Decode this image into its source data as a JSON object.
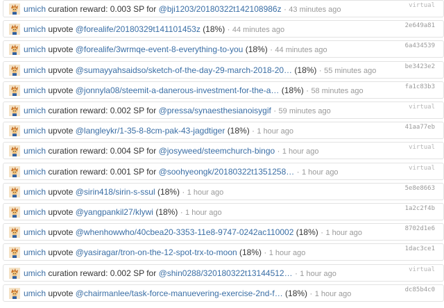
{
  "avatar_icon": "orange-cartoon-character-avatar",
  "colors": {
    "link": "#3a6ea5",
    "muted": "#999999",
    "border": "#e2e2e2"
  },
  "rows": [
    {
      "account": "umich",
      "op": "curation reward: 0.003 SP for",
      "link": "@bji1203/20180322t142108986z",
      "pct": "",
      "time": "43 minutes ago",
      "tx": "virtual"
    },
    {
      "account": "umich",
      "op": "upvote",
      "link": "@forealife/20180329t141101453z",
      "pct": "(18%)",
      "time": "44 minutes ago",
      "tx": "2e649a81"
    },
    {
      "account": "umich",
      "op": "upvote",
      "link": "@forealife/3wrmqe-event-8-everything-to-you",
      "pct": "(18%)",
      "time": "44 minutes ago",
      "tx": "6a434539"
    },
    {
      "account": "umich",
      "op": "upvote",
      "link": "@sumayyahsaidso/sketch-of-the-day-29-march-2018-20…",
      "pct": "(18%)",
      "time": "55 minutes ago",
      "tx": "be3423e2"
    },
    {
      "account": "umich",
      "op": "upvote",
      "link": "@jonnyla08/steemit-a-danerous-investment-for-the-a…",
      "pct": "(18%)",
      "time": "58 minutes ago",
      "tx": "fa1c83b3"
    },
    {
      "account": "umich",
      "op": "curation reward: 0.002 SP for",
      "link": "@pressa/synaesthesianoisygif",
      "pct": "",
      "time": "59 minutes ago",
      "tx": "virtual"
    },
    {
      "account": "umich",
      "op": "upvote",
      "link": "@langleykr/1-35-8-8cm-pak-43-jagdtiger",
      "pct": "(18%)",
      "time": "1 hour ago",
      "tx": "41aa77eb"
    },
    {
      "account": "umich",
      "op": "curation reward: 0.004 SP for",
      "link": "@josyweed/steemchurch-bingo",
      "pct": "",
      "time": "1 hour ago",
      "tx": "virtual"
    },
    {
      "account": "umich",
      "op": "curation reward: 0.001 SP for",
      "link": "@soohyeongk/20180322t1351258…",
      "pct": "",
      "time": "1 hour ago",
      "tx": "virtual"
    },
    {
      "account": "umich",
      "op": "upvote",
      "link": "@sirin418/sirin-s-ssul",
      "pct": "(18%)",
      "time": "1 hour ago",
      "tx": "5e8e8663"
    },
    {
      "account": "umich",
      "op": "upvote",
      "link": "@yangpankil27/klywi",
      "pct": "(18%)",
      "time": "1 hour ago",
      "tx": "1a2c2f4b"
    },
    {
      "account": "umich",
      "op": "upvote",
      "link": "@whenhowwho/40cbea20-3353-11e8-9747-0242ac110002",
      "pct": "(18%)",
      "time": "1 hour ago",
      "tx": "8702d1e6"
    },
    {
      "account": "umich",
      "op": "upvote",
      "link": "@yasiragar/tron-on-the-12-spot-trx-to-moon",
      "pct": "(18%)",
      "time": "1 hour ago",
      "tx": "1dac3ce1"
    },
    {
      "account": "umich",
      "op": "curation reward: 0.002 SP for",
      "link": "@shin0288/320180322t13144512…",
      "pct": "",
      "time": "1 hour ago",
      "tx": "virtual"
    },
    {
      "account": "umich",
      "op": "upvote",
      "link": "@chairmanlee/task-force-manuevering-exercise-2nd-f…",
      "pct": "(18%)",
      "time": "1 hour ago",
      "tx": "dc85b4c0"
    }
  ]
}
